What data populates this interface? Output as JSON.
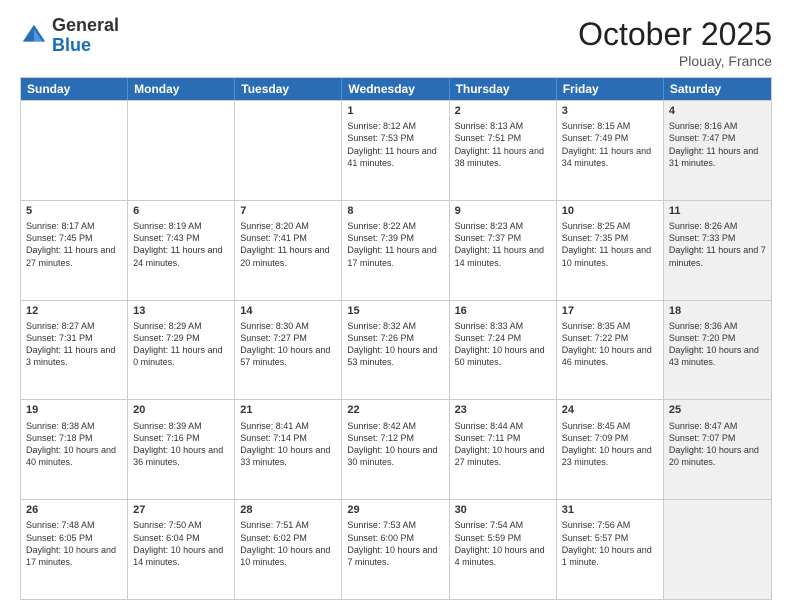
{
  "header": {
    "logo": {
      "line1": "General",
      "line2": "Blue"
    },
    "month_year": "October 2025",
    "location": "Plouay, France"
  },
  "days_of_week": [
    "Sunday",
    "Monday",
    "Tuesday",
    "Wednesday",
    "Thursday",
    "Friday",
    "Saturday"
  ],
  "rows": [
    [
      {
        "day": "",
        "info": "",
        "shaded": false
      },
      {
        "day": "",
        "info": "",
        "shaded": false
      },
      {
        "day": "",
        "info": "",
        "shaded": false
      },
      {
        "day": "1",
        "info": "Sunrise: 8:12 AM\nSunset: 7:53 PM\nDaylight: 11 hours and 41 minutes.",
        "shaded": false
      },
      {
        "day": "2",
        "info": "Sunrise: 8:13 AM\nSunset: 7:51 PM\nDaylight: 11 hours and 38 minutes.",
        "shaded": false
      },
      {
        "day": "3",
        "info": "Sunrise: 8:15 AM\nSunset: 7:49 PM\nDaylight: 11 hours and 34 minutes.",
        "shaded": false
      },
      {
        "day": "4",
        "info": "Sunrise: 8:16 AM\nSunset: 7:47 PM\nDaylight: 11 hours and 31 minutes.",
        "shaded": true
      }
    ],
    [
      {
        "day": "5",
        "info": "Sunrise: 8:17 AM\nSunset: 7:45 PM\nDaylight: 11 hours and 27 minutes.",
        "shaded": false
      },
      {
        "day": "6",
        "info": "Sunrise: 8:19 AM\nSunset: 7:43 PM\nDaylight: 11 hours and 24 minutes.",
        "shaded": false
      },
      {
        "day": "7",
        "info": "Sunrise: 8:20 AM\nSunset: 7:41 PM\nDaylight: 11 hours and 20 minutes.",
        "shaded": false
      },
      {
        "day": "8",
        "info": "Sunrise: 8:22 AM\nSunset: 7:39 PM\nDaylight: 11 hours and 17 minutes.",
        "shaded": false
      },
      {
        "day": "9",
        "info": "Sunrise: 8:23 AM\nSunset: 7:37 PM\nDaylight: 11 hours and 14 minutes.",
        "shaded": false
      },
      {
        "day": "10",
        "info": "Sunrise: 8:25 AM\nSunset: 7:35 PM\nDaylight: 11 hours and 10 minutes.",
        "shaded": false
      },
      {
        "day": "11",
        "info": "Sunrise: 8:26 AM\nSunset: 7:33 PM\nDaylight: 11 hours and 7 minutes.",
        "shaded": true
      }
    ],
    [
      {
        "day": "12",
        "info": "Sunrise: 8:27 AM\nSunset: 7:31 PM\nDaylight: 11 hours and 3 minutes.",
        "shaded": false
      },
      {
        "day": "13",
        "info": "Sunrise: 8:29 AM\nSunset: 7:29 PM\nDaylight: 11 hours and 0 minutes.",
        "shaded": false
      },
      {
        "day": "14",
        "info": "Sunrise: 8:30 AM\nSunset: 7:27 PM\nDaylight: 10 hours and 57 minutes.",
        "shaded": false
      },
      {
        "day": "15",
        "info": "Sunrise: 8:32 AM\nSunset: 7:26 PM\nDaylight: 10 hours and 53 minutes.",
        "shaded": false
      },
      {
        "day": "16",
        "info": "Sunrise: 8:33 AM\nSunset: 7:24 PM\nDaylight: 10 hours and 50 minutes.",
        "shaded": false
      },
      {
        "day": "17",
        "info": "Sunrise: 8:35 AM\nSunset: 7:22 PM\nDaylight: 10 hours and 46 minutes.",
        "shaded": false
      },
      {
        "day": "18",
        "info": "Sunrise: 8:36 AM\nSunset: 7:20 PM\nDaylight: 10 hours and 43 minutes.",
        "shaded": true
      }
    ],
    [
      {
        "day": "19",
        "info": "Sunrise: 8:38 AM\nSunset: 7:18 PM\nDaylight: 10 hours and 40 minutes.",
        "shaded": false
      },
      {
        "day": "20",
        "info": "Sunrise: 8:39 AM\nSunset: 7:16 PM\nDaylight: 10 hours and 36 minutes.",
        "shaded": false
      },
      {
        "day": "21",
        "info": "Sunrise: 8:41 AM\nSunset: 7:14 PM\nDaylight: 10 hours and 33 minutes.",
        "shaded": false
      },
      {
        "day": "22",
        "info": "Sunrise: 8:42 AM\nSunset: 7:12 PM\nDaylight: 10 hours and 30 minutes.",
        "shaded": false
      },
      {
        "day": "23",
        "info": "Sunrise: 8:44 AM\nSunset: 7:11 PM\nDaylight: 10 hours and 27 minutes.",
        "shaded": false
      },
      {
        "day": "24",
        "info": "Sunrise: 8:45 AM\nSunset: 7:09 PM\nDaylight: 10 hours and 23 minutes.",
        "shaded": false
      },
      {
        "day": "25",
        "info": "Sunrise: 8:47 AM\nSunset: 7:07 PM\nDaylight: 10 hours and 20 minutes.",
        "shaded": true
      }
    ],
    [
      {
        "day": "26",
        "info": "Sunrise: 7:48 AM\nSunset: 6:05 PM\nDaylight: 10 hours and 17 minutes.",
        "shaded": false
      },
      {
        "day": "27",
        "info": "Sunrise: 7:50 AM\nSunset: 6:04 PM\nDaylight: 10 hours and 14 minutes.",
        "shaded": false
      },
      {
        "day": "28",
        "info": "Sunrise: 7:51 AM\nSunset: 6:02 PM\nDaylight: 10 hours and 10 minutes.",
        "shaded": false
      },
      {
        "day": "29",
        "info": "Sunrise: 7:53 AM\nSunset: 6:00 PM\nDaylight: 10 hours and 7 minutes.",
        "shaded": false
      },
      {
        "day": "30",
        "info": "Sunrise: 7:54 AM\nSunset: 5:59 PM\nDaylight: 10 hours and 4 minutes.",
        "shaded": false
      },
      {
        "day": "31",
        "info": "Sunrise: 7:56 AM\nSunset: 5:57 PM\nDaylight: 10 hours and 1 minute.",
        "shaded": false
      },
      {
        "day": "",
        "info": "",
        "shaded": true
      }
    ]
  ]
}
